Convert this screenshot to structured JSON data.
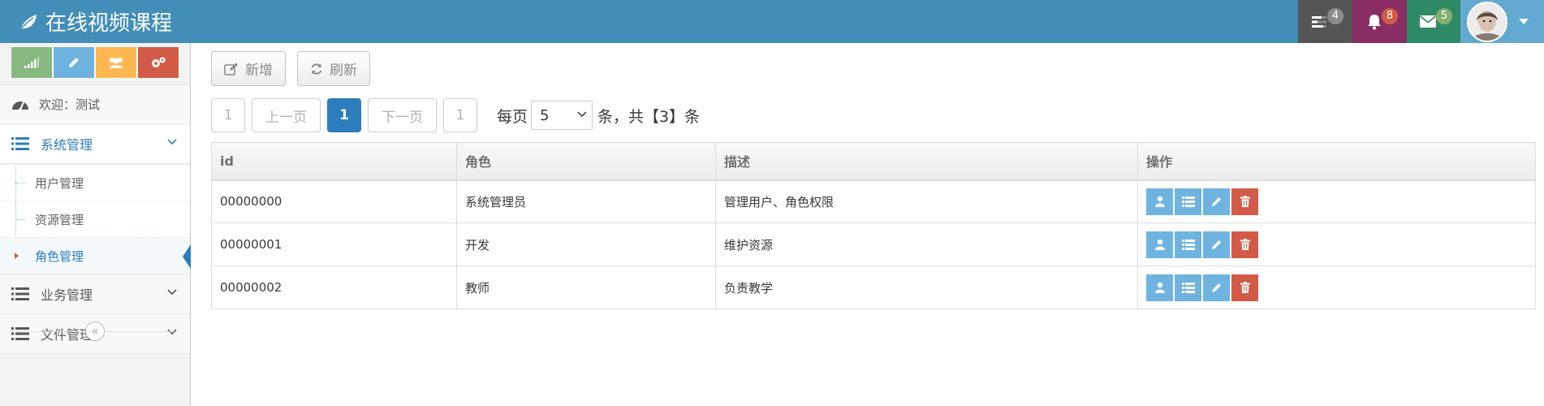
{
  "navbar": {
    "brand": "在线视频课程",
    "tasks_count": "4",
    "notifications_count": "8",
    "messages_count": "5"
  },
  "sidebar": {
    "welcome": "欢迎：测试",
    "menus": [
      {
        "label": "系统管理",
        "open": true,
        "items": [
          {
            "label": "用户管理"
          },
          {
            "label": "资源管理"
          },
          {
            "label": "角色管理",
            "active": true
          }
        ]
      },
      {
        "label": "业务管理"
      },
      {
        "label": "文件管理"
      }
    ],
    "collapse_symbol": "«"
  },
  "toolbar": {
    "add_label": "新增",
    "refresh_label": "刷新"
  },
  "pager": {
    "first": "1",
    "prev": "上一页",
    "current": "1",
    "next": "下一页",
    "last": "1",
    "per_page_prefix": "每页",
    "per_page_value": "5",
    "summary": "条，共【3】条"
  },
  "table": {
    "headers": [
      "id",
      "角色",
      "描述",
      "操作"
    ],
    "rows": [
      [
        "00000000",
        "系统管理员",
        "管理用户、角色权限"
      ],
      [
        "00000001",
        "开发",
        "维护资源"
      ],
      [
        "00000002",
        "教师",
        "负责教学"
      ]
    ]
  },
  "colors": {
    "navbar": "#438eb9",
    "primary": "#2b7dbc",
    "op_blue": "#6fb3e0",
    "op_red": "#d15b47"
  },
  "icons": {
    "brand": "leaf-icon",
    "tasks": "tasks-icon",
    "notifications": "bell-icon",
    "messages": "envelope-icon",
    "row_actions": [
      "user-icon",
      "list-icon",
      "pencil-icon",
      "trash-icon"
    ]
  }
}
